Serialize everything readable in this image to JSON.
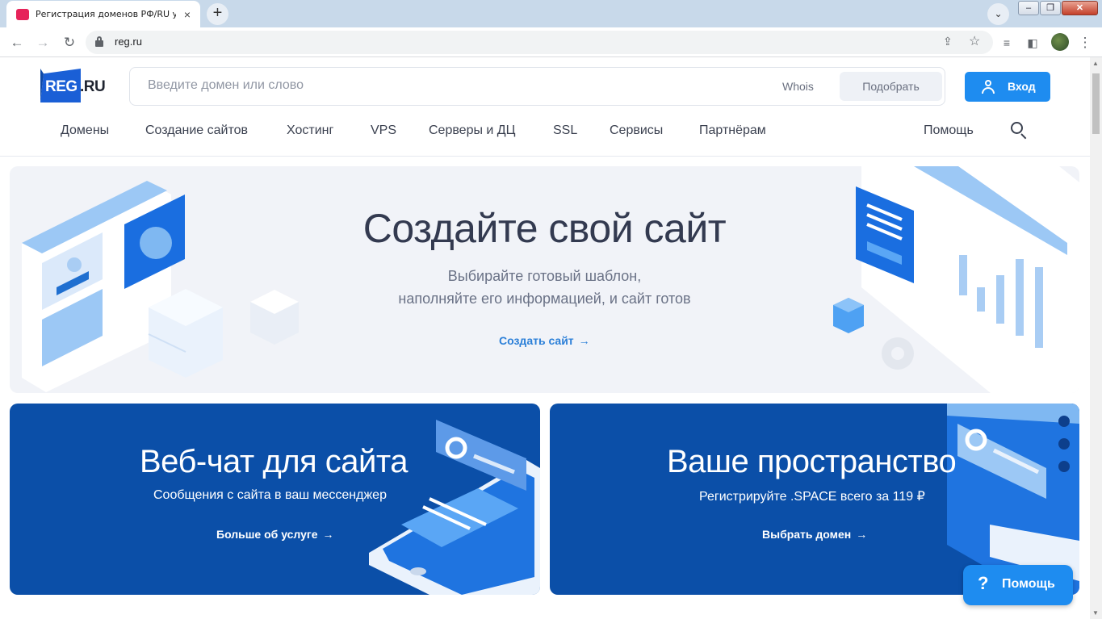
{
  "browser": {
    "tab_title": "Регистрация доменов РФ/RU у а",
    "tab_close": "×",
    "new_tab": "+",
    "url": "reg.ru",
    "window_min": "–",
    "window_max": "❐",
    "window_close": "✕"
  },
  "header": {
    "logo_reg": "REG",
    "logo_ru": ".RU",
    "search_placeholder": "Введите домен или слово",
    "whois": "Whois",
    "pick_button": "Подобрать",
    "login_button": "Вход"
  },
  "nav": {
    "items": [
      "Домены",
      "Создание сайтов",
      "Хостинг",
      "VPS",
      "Серверы и ДЦ",
      "SSL",
      "Сервисы",
      "Партнёрам"
    ],
    "help": "Помощь"
  },
  "hero": {
    "title": "Создайте свой сайт",
    "subtitle_line1": "Выбирайте готовый шаблон,",
    "subtitle_line2": "наполняйте его информацией, и сайт готов",
    "cta": "Создать сайт"
  },
  "cards": [
    {
      "title": "Веб-чат для сайта",
      "subtitle": "Сообщения с сайта в ваш мессенджер",
      "cta": "Больше об услуге"
    },
    {
      "title": "Ваше пространство",
      "subtitle": "Регистрируйте .SPACE всего за 119 ₽",
      "cta": "Выбрать домен"
    }
  ],
  "help_widget": {
    "icon": "?",
    "label": "Помощь"
  },
  "colors": {
    "brand_blue": "#1e8cf0",
    "card_blue": "#0b4fa8",
    "hero_bg": "#f1f3f8"
  }
}
